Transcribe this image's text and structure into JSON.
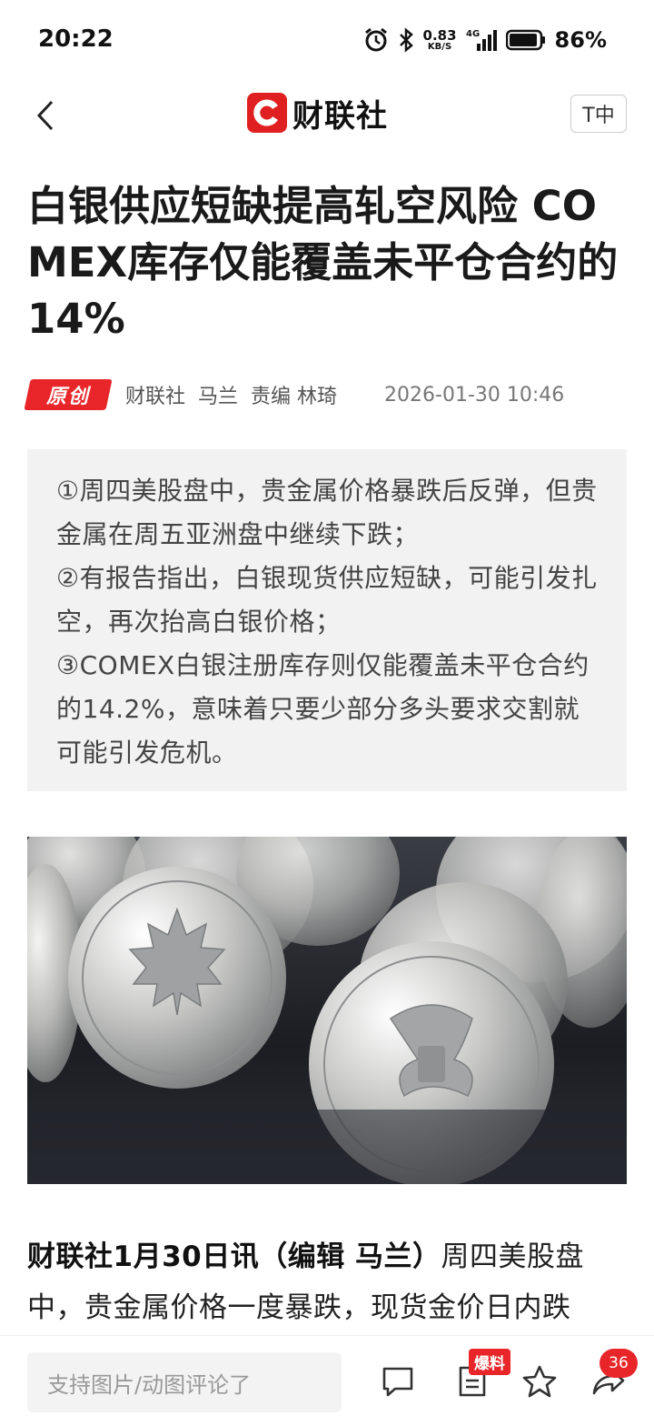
{
  "status_bar": {
    "time": "20:22",
    "net_speed_value": "0.83",
    "net_speed_unit": "KB/S",
    "network": "4G",
    "battery": "86%"
  },
  "nav": {
    "back_icon": "chevron-left-icon",
    "logo_text": "财联社",
    "font_size_label": "T中"
  },
  "article": {
    "title": "白银供应短缺提高轧空风险 COMEX库存仅能覆盖未平仓合约的14%",
    "badge": "原创",
    "source": "财联社",
    "author": "马兰",
    "editor": "责编 林琦",
    "date": "2026-01-30 10:46",
    "summary": [
      "①周四美股盘中，贵金属价格暴跌后反弹，但贵金属在周五亚洲盘中继续下跌；",
      "②有报告指出，白银现货供应短缺，可能引发扎空，再次抬高白银价格；",
      "③COMEX白银注册库存则仅能覆盖未平仓合约的14.2%，意味着只要少部分多头要求交割就可能引发危机。"
    ],
    "body_lead": "财联社1月30日讯（编辑 马兰）",
    "body_text": "周四美股盘中，贵金属价格一度暴跌，现货金价日内跌"
  },
  "bottom_bar": {
    "comment_placeholder": "支持图片/动图评论了",
    "tipoff_label": "爆料",
    "share_count": "36"
  },
  "colors": {
    "brand_red": "#e8262a",
    "summary_bg": "#f2f2f2"
  }
}
